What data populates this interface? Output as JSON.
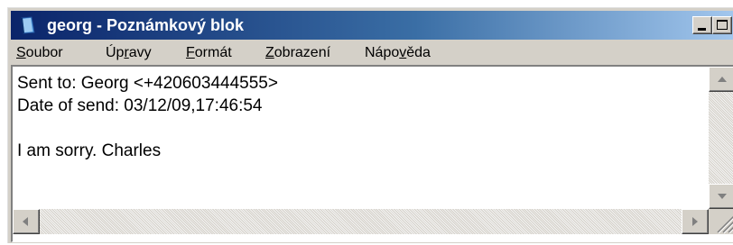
{
  "window": {
    "title": "georg - Poznámkový blok"
  },
  "menu": {
    "items": [
      {
        "prefix": "",
        "accel": "S",
        "suffix": "oubor"
      },
      {
        "prefix": "Úp",
        "accel": "r",
        "suffix": "avy"
      },
      {
        "prefix": "",
        "accel": "F",
        "suffix": "ormát"
      },
      {
        "prefix": "",
        "accel": "Z",
        "suffix": "obrazení"
      },
      {
        "prefix": "Nápo",
        "accel": "v",
        "suffix": "ěda"
      }
    ]
  },
  "document": {
    "lines": [
      "Sent to: Georg <+420603444555>",
      "Date of send: 03/12/09,17:46:54",
      "",
      "I am sorry. Charles"
    ]
  },
  "colors": {
    "title_start": "#0a246a",
    "title_end": "#a6caf0",
    "chrome": "#d4d0c8"
  },
  "icons": {
    "app": "notepad-icon",
    "minimize": "minimize-icon",
    "maximize": "maximize-icon",
    "close": "close-icon"
  }
}
